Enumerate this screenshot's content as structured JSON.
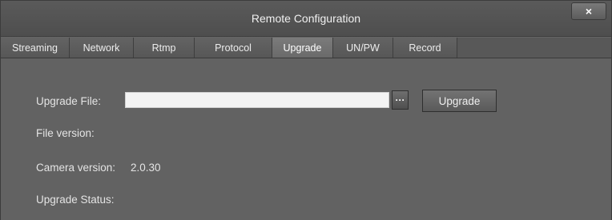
{
  "window": {
    "title": "Remote Configuration",
    "close_label": "×"
  },
  "tabs": [
    {
      "label": "Streaming",
      "active": false
    },
    {
      "label": "Network",
      "active": false
    },
    {
      "label": "Rtmp",
      "active": false
    },
    {
      "label": "Protocol",
      "active": false
    },
    {
      "label": "Upgrade",
      "active": true
    },
    {
      "label": "UN/PW",
      "active": false
    },
    {
      "label": "Record",
      "active": false
    }
  ],
  "upgrade": {
    "file_label": "Upgrade File:",
    "file_value": "",
    "browse_label": "···",
    "button_label": "Upgrade",
    "file_version_label": "File version:",
    "file_version_value": "",
    "camera_version_label": "Camera version:",
    "camera_version_value": "2.0.30",
    "status_label": "Upgrade Status:",
    "status_value": ""
  }
}
